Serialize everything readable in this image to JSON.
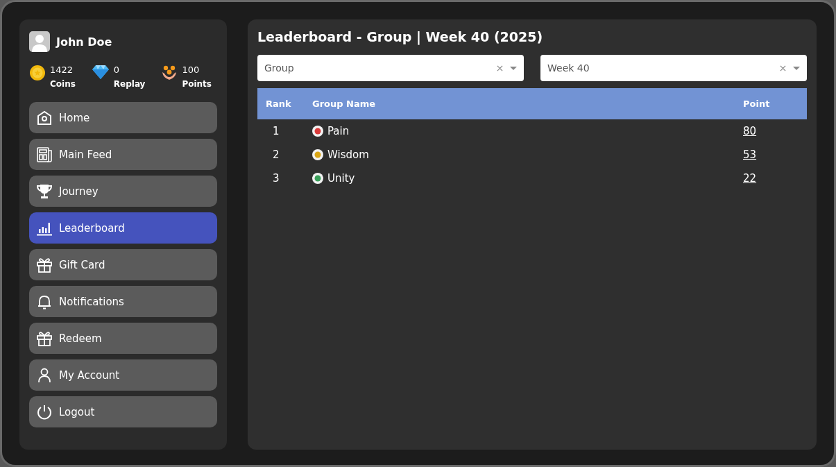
{
  "user": {
    "name": "John Doe"
  },
  "stats": [
    {
      "kind": "coin",
      "value": "1422",
      "label": "Coins"
    },
    {
      "kind": "gem",
      "value": "0",
      "label": "Replay"
    },
    {
      "kind": "hands",
      "value": "100",
      "label": "Points"
    }
  ],
  "nav": [
    {
      "kind": "home",
      "label": "Home",
      "selected": false
    },
    {
      "kind": "feed",
      "label": "Main Feed",
      "selected": false
    },
    {
      "kind": "trophy",
      "label": "Journey",
      "selected": false
    },
    {
      "kind": "chart",
      "label": "Leaderboard",
      "selected": true
    },
    {
      "kind": "gift",
      "label": "Gift Card",
      "selected": false
    },
    {
      "kind": "bell",
      "label": "Notifications",
      "selected": false
    },
    {
      "kind": "gift",
      "label": "Redeem",
      "selected": false
    },
    {
      "kind": "user",
      "label": "My Account",
      "selected": false
    },
    {
      "kind": "power",
      "label": "Logout",
      "selected": false
    }
  ],
  "title": "Leaderboard - Group | Week 40 (2025)",
  "filters": [
    {
      "value": "Group"
    },
    {
      "value": "Week 40"
    }
  ],
  "table": {
    "columns": [
      "Rank",
      "Group Name",
      "Point"
    ],
    "rows": [
      {
        "rank": "1",
        "kind": "red",
        "name": "Pain",
        "point": "80"
      },
      {
        "rank": "2",
        "kind": "yellow",
        "name": "Wisdom",
        "point": "53"
      },
      {
        "rank": "3",
        "kind": "green",
        "name": "Unity",
        "point": "22"
      }
    ]
  }
}
